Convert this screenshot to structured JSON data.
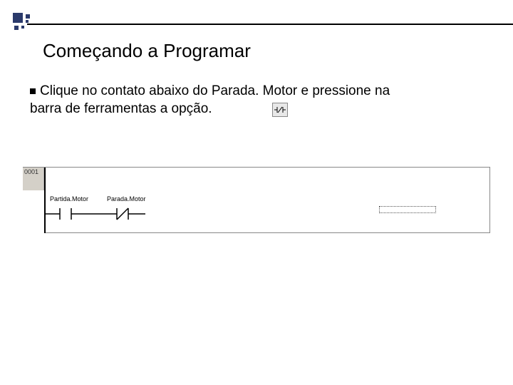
{
  "title": "Começando a Programar",
  "body": {
    "line1_prefix": "Clique no contato abaixo do Parada. Motor e pressione na",
    "line2_prefix": "barra de ferramentas a opção."
  },
  "ladder": {
    "rung_number": "0001",
    "contacts": [
      {
        "label": "Partida.Motor"
      },
      {
        "label": "Parada.Motor"
      }
    ]
  },
  "icons": {
    "toolbar_option": "nc-contact-icon"
  }
}
